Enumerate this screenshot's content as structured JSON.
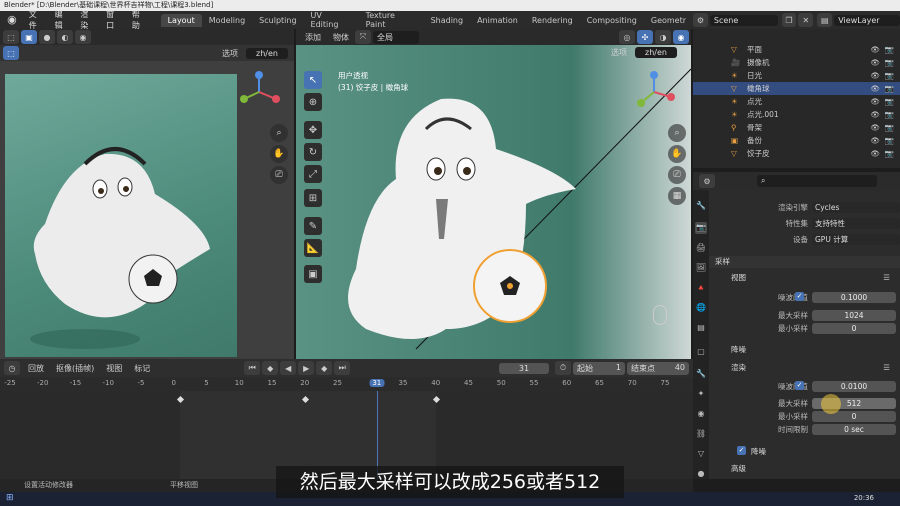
{
  "window": {
    "title": "Blender* [D:\\Blender\\基础课程\\世界杯吉祥物\\工程\\课程3.blend]"
  },
  "menu": [
    "文件",
    "编辑",
    "渲染",
    "窗口",
    "帮助"
  ],
  "workspaces": [
    "Layout",
    "Modeling",
    "Sculpting",
    "UV Editing",
    "Texture Paint",
    "Shading",
    "Animation",
    "Rendering",
    "Compositing",
    "Geometr"
  ],
  "active_workspace": "Layout",
  "scene": {
    "name": "Scene",
    "view_layer": "ViewLayer"
  },
  "viewport_left": {
    "options_label": "选项",
    "lang_label": "zh/en"
  },
  "viewport_right": {
    "menu": [
      "添加",
      "物体"
    ],
    "orientation": "全局",
    "options_label": "选项",
    "lang_label": "zh/en",
    "overlay_title": "用户透视",
    "overlay_sub": "(31) 饺子皮 | 橄角球"
  },
  "outliner": {
    "items": [
      {
        "label": "平面"
      },
      {
        "label": "摄像机"
      },
      {
        "label": "日光"
      },
      {
        "label": "橄角球",
        "selected": true
      },
      {
        "label": "点光"
      },
      {
        "label": "点光.001"
      },
      {
        "label": "骨架"
      },
      {
        "label": "备份"
      },
      {
        "label": "饺子皮"
      }
    ]
  },
  "timeline": {
    "menu": [
      "回放",
      "抠像(插帧)",
      "视图",
      "标记"
    ],
    "current_frame": "31",
    "start_label": "起始",
    "start": "1",
    "end_label": "结束点",
    "end": "40",
    "ticks": [
      "-25",
      "-20",
      "-15",
      "-10",
      "-5",
      "0",
      "5",
      "10",
      "15",
      "20",
      "25",
      "31",
      "35",
      "40",
      "45",
      "50",
      "55",
      "60",
      "65",
      "70",
      "75"
    ],
    "tick_values": [
      -25,
      -20,
      -15,
      -10,
      -5,
      0,
      5,
      10,
      15,
      20,
      25,
      31,
      35,
      40,
      45,
      50,
      55,
      60,
      65,
      70,
      75
    ],
    "keyframes": [
      1,
      20,
      40
    ]
  },
  "status": {
    "left": "设置活动修改器",
    "mid": "平移视图"
  },
  "properties": {
    "render_engine_label": "渲染引擎",
    "render_engine": "Cycles",
    "feature_set_label": "特性集",
    "feature_set": "支持特性",
    "device_label": "设备",
    "device": "GPU 计算",
    "sampling_label": "采样",
    "viewport_label": "视图",
    "noise_label": "噪波阈值",
    "vp_noise": "0.1000",
    "max_samples_label": "最大采样",
    "vp_max": "1024",
    "min_samples_label": "最小采样",
    "vp_min": "0",
    "denoise_label": "降噪",
    "render_label": "渲染",
    "r_noise": "0.0100",
    "r_max": "512",
    "r_min": "0",
    "time_limit_label": "时间限制",
    "r_time": "0 sec",
    "denoise2_label": "降噪",
    "advanced_label": "高级"
  },
  "taskbar": {
    "time": "20:36"
  },
  "subtitle": "然后最大采样可以改成256或者512",
  "colors": {
    "accent": "#4772b3",
    "selection": "#334d80"
  }
}
